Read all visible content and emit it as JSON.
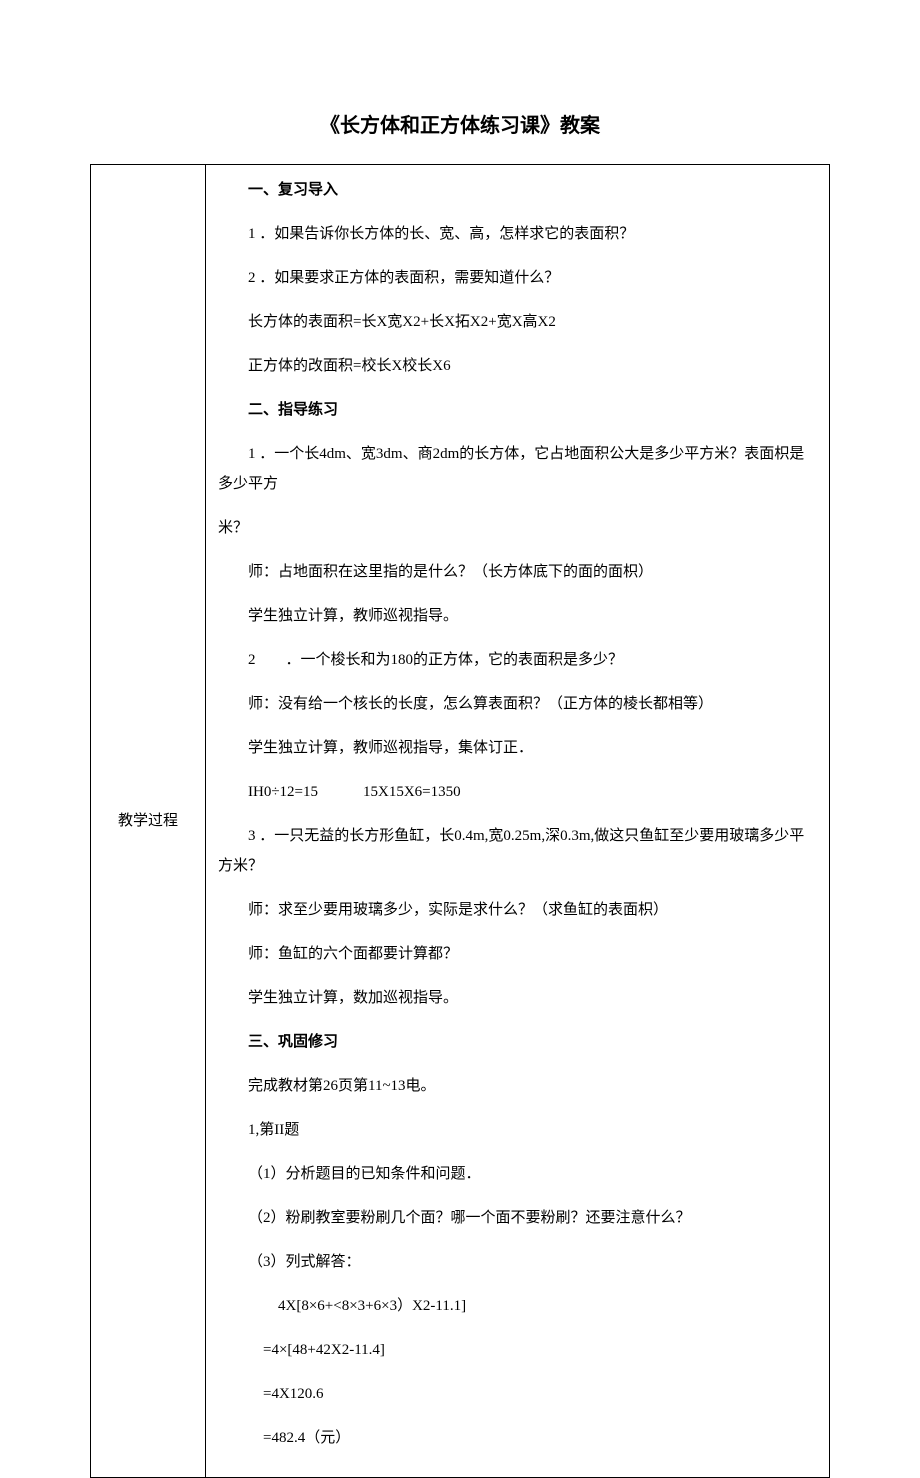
{
  "title": "《长方体和正方体练习课》教案",
  "label": "教学过程",
  "section1_heading": "一、复习导入",
  "s1_p1": "1 ．如果告诉你长方体的长、宽、高，怎样求它的表面积？",
  "s1_p2": "2 ．如果要求正方体的表面积，需要知道什么？",
  "s1_p3": "长方体的表面积=长X宽X2+长X拓X2+宽X高X2",
  "s1_p4": "正方体的改面积=校长X校长X6",
  "section2_heading": "二、指导练习",
  "s2_p1": "1 ．一个长4dm、宽3dm、商2dm的长方体，它占地面积公大是多少平方米？表面枳是多少平方",
  "s2_p1b": "米？",
  "s2_p2": "师：占地面积在这里指的是什么？（长方体底下的面的面枳）",
  "s2_p3": "学生独立计算，教师巡视指导。",
  "s2_p4": "2  ．一个梭长和为180的正方体，它的表面积是多少？",
  "s2_p5": "师：没有给一个核长的长度，怎么算表面积？（正方体的棱长都相等）",
  "s2_p6": "学生独立计算，教师巡视指导，集体订正．",
  "s2_p7": "IH0÷12=15   15X15X6=1350",
  "s2_p8": "3 ．一只无益的长方形鱼缸，长0.4m,宽0.25m,深0.3m,做这只鱼缸至少要用玻璃多少平方米？",
  "s2_p9": "师：求至少要用玻璃多少，实际是求什么？（求鱼缸的表面枳）",
  "s2_p10": "师：鱼缸的六个面都要计算都？",
  "s2_p11": "学生独立计算，数加巡视指导。",
  "section3_heading": "三、巩固修习",
  "s3_p1": "完成教材第26页第11~13电。",
  "s3_p2": "1,第II题",
  "s3_p3": "（1）分析题目的已知条件和问题．",
  "s3_p4": "（2）粉刷教室要粉刷几个面？哪一个面不要粉刷？还要注意什么？",
  "s3_p5": "（3）列式解答：",
  "s3_p6": "4X[8×6+<8×3+6×3）X2-11.1]",
  "s3_p7": "=4×[48+42X2-11.4]",
  "s3_p8": "=4X120.6",
  "s3_p9": "=482.4（元）"
}
